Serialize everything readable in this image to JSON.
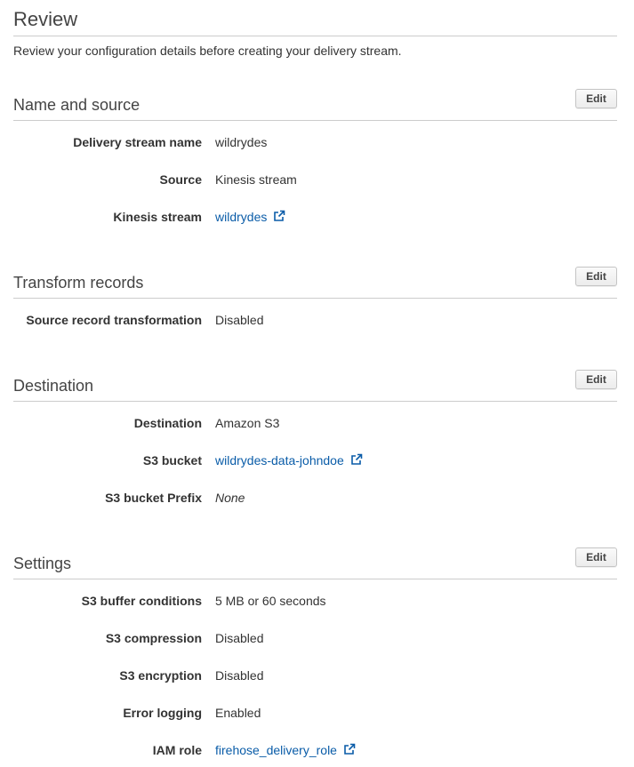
{
  "page": {
    "title": "Review",
    "intro": "Review your configuration details before creating your delivery stream."
  },
  "edit_label": "Edit",
  "sections": {
    "name_source": {
      "title": "Name and source",
      "rows": [
        {
          "label": "Delivery stream name",
          "value": "wildrydes"
        },
        {
          "label": "Source",
          "value": "Kinesis stream"
        },
        {
          "label": "Kinesis stream",
          "value": "wildrydes",
          "link": true
        }
      ]
    },
    "transform": {
      "title": "Transform records",
      "rows": [
        {
          "label": "Source record transformation",
          "value": "Disabled"
        }
      ]
    },
    "destination": {
      "title": "Destination",
      "rows": [
        {
          "label": "Destination",
          "value": "Amazon S3"
        },
        {
          "label": "S3 bucket",
          "value": "wildrydes-data-johndoe",
          "link": true
        },
        {
          "label": "S3 bucket Prefix",
          "value": "None"
        }
      ]
    },
    "settings": {
      "title": "Settings",
      "rows": [
        {
          "label": "S3 buffer conditions",
          "value": "5 MB or 60 seconds"
        },
        {
          "label": "S3 compression",
          "value": "Disabled"
        },
        {
          "label": "S3 encryption",
          "value": "Disabled"
        },
        {
          "label": "Error logging",
          "value": "Enabled"
        },
        {
          "label": "IAM role",
          "value": "firehose_delivery_role",
          "link": true
        }
      ]
    }
  },
  "icons": {
    "external_link": "external-link-icon"
  },
  "colors": {
    "link": "#0a5ca8",
    "rule": "#cccccc"
  }
}
